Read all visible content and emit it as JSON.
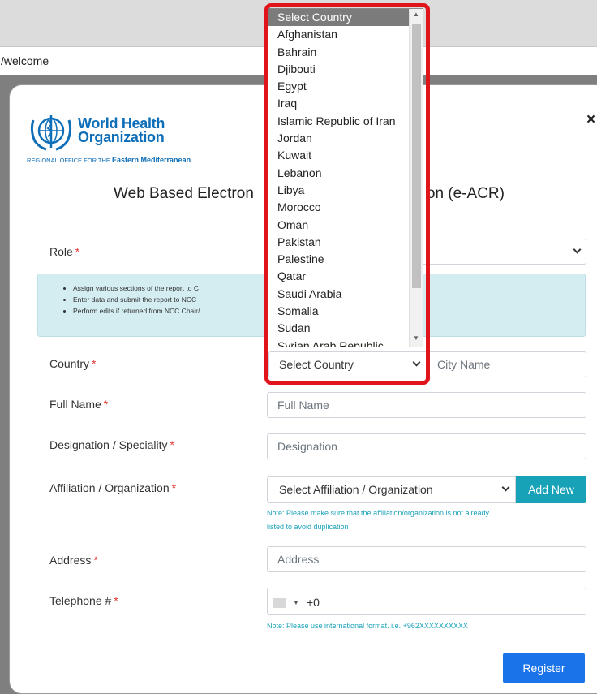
{
  "browser": {
    "url_fragment": "/welcome"
  },
  "logo": {
    "word1": "World Health",
    "word2": "Organization",
    "region_prefix": "REGIONAL OFFICE FOR THE",
    "region_name": "Eastern Mediterranean"
  },
  "modal": {
    "title": "Web Based Electronic Annual Country Reporting System Registration (e-ACR)",
    "title_left": "Web Based Electron",
    "title_right": "on (e-ACR)",
    "close_symbol": "×"
  },
  "form": {
    "role_label": "Role",
    "required_mark": "*",
    "info_items": [
      "Assign various sections of the report to C",
      "Enter data and submit the report to NCC",
      "Perform edits if returned from NCC Chair/"
    ],
    "country_label": "Country",
    "country_selected": "Select Country",
    "city_placeholder": "City Name",
    "fullname_label": "Full Name",
    "fullname_placeholder": "Full Name",
    "designation_label": "Designation / Speciality",
    "designation_placeholder": "Designation",
    "affiliation_label": "Affiliation / Organization",
    "affiliation_selected": "Select Affiliation / Organization",
    "add_new_label": "Add New",
    "affiliation_note_line1": "Note: Please make sure that the affiliation/organization is not already",
    "affiliation_note_line2": "listed to avoid duplication",
    "address_label": "Address",
    "address_placeholder": "Address",
    "telephone_label": "Telephone #",
    "telephone_code": "+0",
    "telephone_note": "Note: Please use international format. i.e. +962XXXXXXXXXX",
    "register_label": "Register"
  },
  "country_dropdown": {
    "options": [
      "Select Country",
      "Afghanistan",
      "Bahrain",
      "Djibouti",
      "Egypt",
      "Iraq",
      "Islamic Republic of Iran",
      "Jordan",
      "Kuwait",
      "Lebanon",
      "Libya",
      "Morocco",
      "Oman",
      "Pakistan",
      "Palestine",
      "Qatar",
      "Saudi Arabia",
      "Somalia",
      "Sudan",
      "Syrian Arab Republic"
    ],
    "highlight_color": "#e2141b"
  }
}
